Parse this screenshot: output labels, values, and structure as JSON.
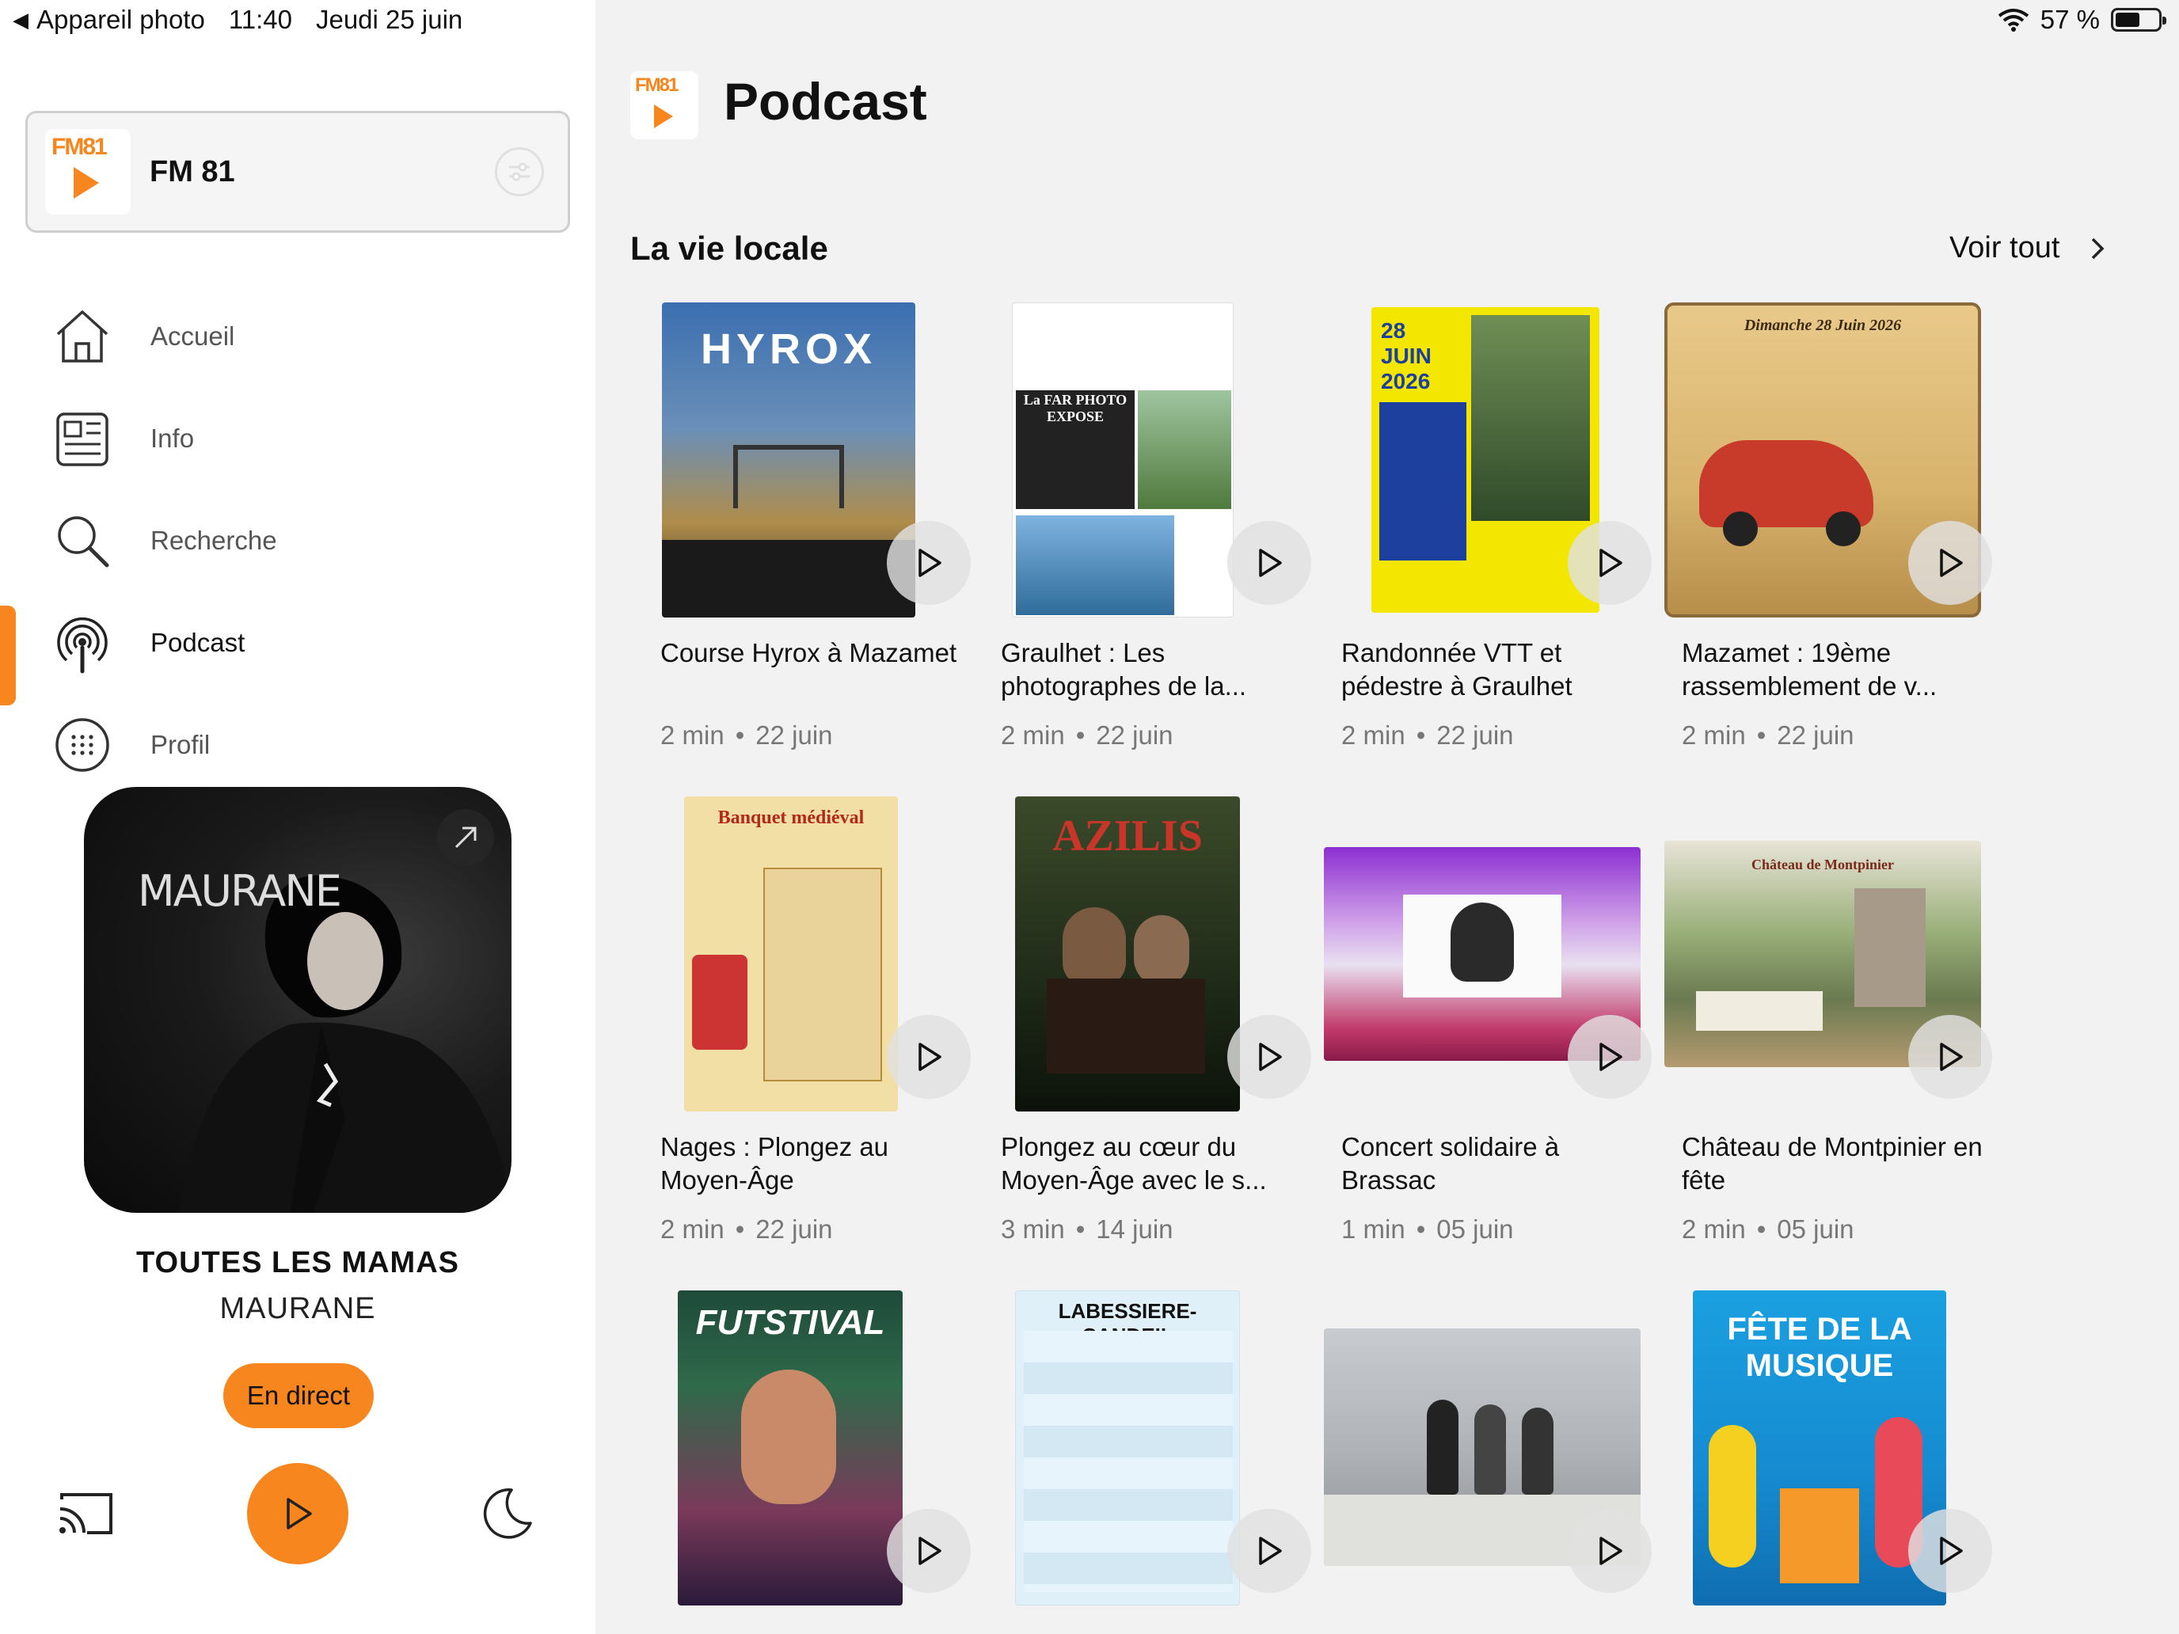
{
  "status_bar": {
    "back_app": "Appareil photo",
    "time": "11:40",
    "date": "Jeudi 25 juin",
    "battery": "57 %",
    "battery_level": 0.57
  },
  "sidebar": {
    "station": {
      "logo_text": "FM81",
      "name": "FM 81"
    },
    "nav": [
      {
        "label": "Accueil",
        "icon": "home-icon"
      },
      {
        "label": "Info",
        "icon": "news-icon"
      },
      {
        "label": "Recherche",
        "icon": "search-icon"
      },
      {
        "label": "Podcast",
        "icon": "podcast-icon",
        "active": true
      },
      {
        "label": "Profil",
        "icon": "profile-icon"
      }
    ],
    "now_playing": {
      "cover_text": "MAURANE",
      "title": "TOUTES LES MAMAS",
      "artist": "MAURANE",
      "live_label": "En direct"
    }
  },
  "main": {
    "logo_text": "FM81",
    "page_title": "Podcast",
    "section": {
      "title": "La vie locale",
      "see_all": "Voir tout"
    },
    "episodes": [
      {
        "title": "Course Hyrox à Mazamet",
        "duration": "2 min",
        "date": "22 juin",
        "poster_text": "HYROX"
      },
      {
        "title": "Graulhet : Les photographes de la...",
        "duration": "2 min",
        "date": "22 juin",
        "poster_text": "La FAR PHOTO EXPOSE"
      },
      {
        "title": "Randonnée VTT et pédestre à Graulhet",
        "duration": "2 min",
        "date": "22 juin",
        "poster_text": "28 JUIN 2026"
      },
      {
        "title": "Mazamet : 19ème rassemblement de v...",
        "duration": "2 min",
        "date": "22 juin",
        "poster_text": "Dimanche 28 Juin 2026"
      },
      {
        "title": "Nages : Plongez au Moyen-Âge",
        "duration": "2 min",
        "date": "22 juin",
        "poster_text": "Banquet médiéval"
      },
      {
        "title": "Plongez au cœur du Moyen-Âge avec le s...",
        "duration": "3 min",
        "date": "14 juin",
        "poster_text": "AZILIS"
      },
      {
        "title": "Concert solidaire à Brassac",
        "duration": "1 min",
        "date": "05 juin",
        "poster_text": ""
      },
      {
        "title": "Château de Montpinier en fête",
        "duration": "2 min",
        "date": "05 juin",
        "poster_text": "Château de Montpinier"
      },
      {
        "title": "",
        "duration": "",
        "date": "",
        "poster_text": "FUTSTIVAL"
      },
      {
        "title": "",
        "duration": "",
        "date": "",
        "poster_text": "LABESSIERE-CANDEIL"
      },
      {
        "title": "",
        "duration": "",
        "date": "",
        "poster_text": ""
      },
      {
        "title": "",
        "duration": "",
        "date": "",
        "poster_text": "FÊTE DE LA MUSIQUE"
      }
    ]
  },
  "colors": {
    "accent": "#f7861e",
    "sidebar_bg": "#ffffff",
    "main_bg": "#f2f2f2",
    "meta_text": "#777777"
  }
}
